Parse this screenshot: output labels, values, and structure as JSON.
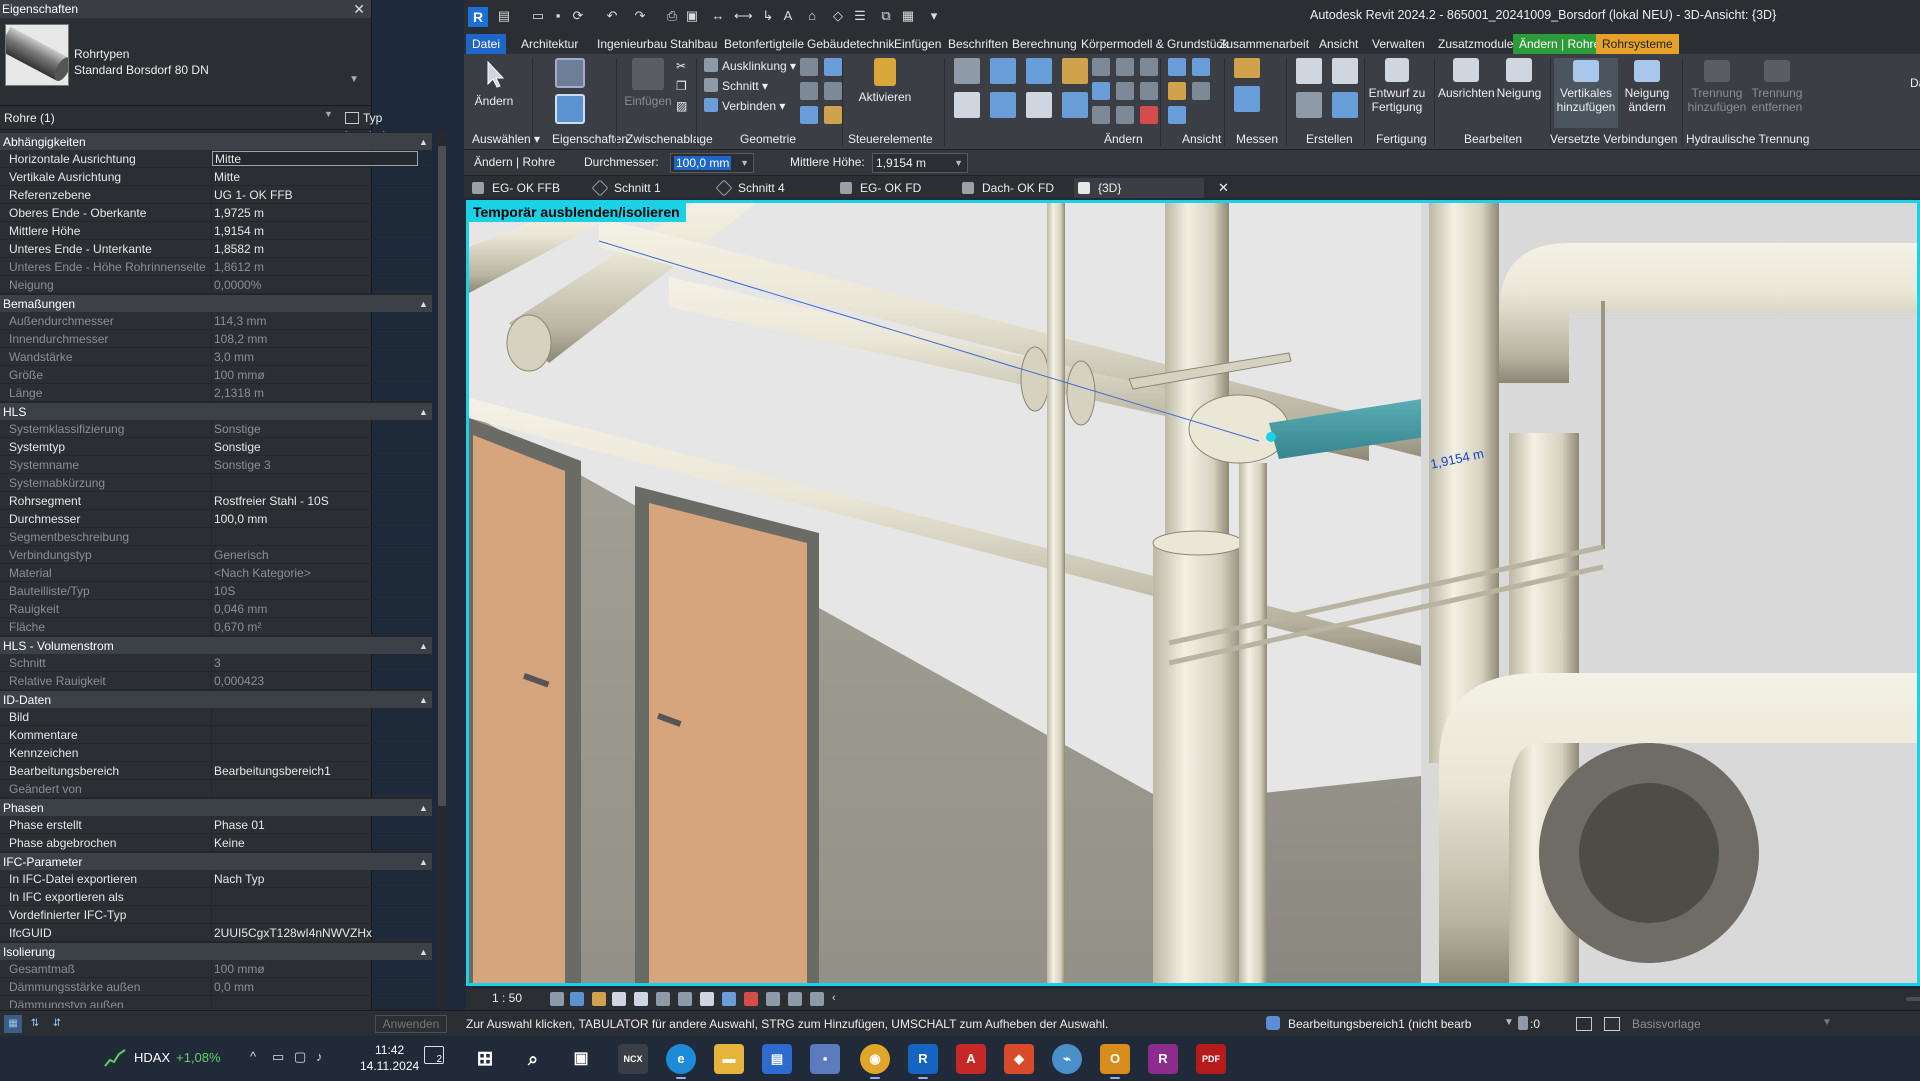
{
  "properties": {
    "title": "Eigenschaften",
    "type_family": "Rohrtypen",
    "type_name": "Standard Borsdorf 80 DN",
    "instance_filter": "Rohre (1)",
    "edit_type": "Typ bearbeiten",
    "apply": "Anwenden",
    "sections": [
      {
        "title": "Abhängigkeiten",
        "rows": [
          {
            "name": "Horizontale Ausrichtung",
            "value": "Mitte",
            "state": "edit"
          },
          {
            "name": "Vertikale Ausrichtung",
            "value": "Mitte",
            "state": ""
          },
          {
            "name": "Referenzebene",
            "value": "UG 1- OK FFB",
            "state": ""
          },
          {
            "name": "Oberes Ende - Oberkante",
            "value": "1,9725 m",
            "state": ""
          },
          {
            "name": "Mittlere Höhe",
            "value": "1,9154 m",
            "state": ""
          },
          {
            "name": "Unteres Ende - Unterkante",
            "value": "1,8582 m",
            "state": ""
          },
          {
            "name": "Unteres Ende - Höhe Rohrinnenseite",
            "value": "1,8612 m",
            "state": "dim"
          },
          {
            "name": "Neigung",
            "value": "0,0000%",
            "state": "dim"
          }
        ]
      },
      {
        "title": "Bemaßungen",
        "rows": [
          {
            "name": "Außendurchmesser",
            "value": "114,3 mm",
            "state": "dim"
          },
          {
            "name": "Innendurchmesser",
            "value": "108,2 mm",
            "state": "dim"
          },
          {
            "name": "Wandstärke",
            "value": "3,0 mm",
            "state": "dim"
          },
          {
            "name": "Größe",
            "value": "100 mmø",
            "state": "dim"
          },
          {
            "name": "Länge",
            "value": "2,1318 m",
            "state": "dim"
          }
        ]
      },
      {
        "title": "HLS",
        "rows": [
          {
            "name": "Systemklassifizierung",
            "value": "Sonstige",
            "state": "dim"
          },
          {
            "name": "Systemtyp",
            "value": "Sonstige",
            "state": ""
          },
          {
            "name": "Systemname",
            "value": "Sonstige 3",
            "state": "dim"
          },
          {
            "name": "Systemabkürzung",
            "value": "",
            "state": "dim"
          },
          {
            "name": "Rohrsegment",
            "value": "Rostfreier Stahl - 10S",
            "state": ""
          },
          {
            "name": "Durchmesser",
            "value": "100,0 mm",
            "state": ""
          },
          {
            "name": "Segmentbeschreibung",
            "value": "",
            "state": "dim"
          },
          {
            "name": "Verbindungstyp",
            "value": "Generisch",
            "state": "dim"
          },
          {
            "name": "Material",
            "value": "<Nach Kategorie>",
            "state": "dim"
          },
          {
            "name": "Bauteilliste/Typ",
            "value": "10S",
            "state": "dim"
          },
          {
            "name": "Rauigkeit",
            "value": "0,046 mm",
            "state": "dim"
          },
          {
            "name": "Fläche",
            "value": "0,670 m²",
            "state": "dim"
          }
        ]
      },
      {
        "title": "HLS - Volumenstrom",
        "rows": [
          {
            "name": "Schnitt",
            "value": "3",
            "state": "dim"
          },
          {
            "name": "Relative Rauigkeit",
            "value": "0,000423",
            "state": "dim"
          }
        ]
      },
      {
        "title": "ID-Daten",
        "rows": [
          {
            "name": "Bild",
            "value": "",
            "state": ""
          },
          {
            "name": "Kommentare",
            "value": "",
            "state": ""
          },
          {
            "name": "Kennzeichen",
            "value": "",
            "state": ""
          },
          {
            "name": "Bearbeitungsbereich",
            "value": "Bearbeitungsbereich1",
            "state": ""
          },
          {
            "name": "Geändert von",
            "value": "",
            "state": "dim"
          }
        ]
      },
      {
        "title": "Phasen",
        "rows": [
          {
            "name": "Phase erstellt",
            "value": "Phase 01",
            "state": ""
          },
          {
            "name": "Phase abgebrochen",
            "value": "Keine",
            "state": ""
          }
        ]
      },
      {
        "title": "IFC-Parameter",
        "rows": [
          {
            "name": "In IFC-Datei exportieren",
            "value": "Nach Typ",
            "state": ""
          },
          {
            "name": "In IFC exportieren als",
            "value": "",
            "state": ""
          },
          {
            "name": "Vordefinierter IFC-Typ",
            "value": "",
            "state": ""
          },
          {
            "name": "IfcGUID",
            "value": "2UUI5CgxT128wI4nNWVZHx",
            "state": ""
          }
        ]
      },
      {
        "title": "Isolierung",
        "rows": [
          {
            "name": "Gesamtmaß",
            "value": "100 mmø",
            "state": "dim"
          },
          {
            "name": "Dämmungsstärke außen",
            "value": "0,0 mm",
            "state": "dim"
          },
          {
            "name": "Dämmungstyp außen",
            "value": "",
            "state": "dim"
          }
        ]
      }
    ]
  },
  "window_title": "Autodesk Revit 2024.2 - 865001_20241009_Borsdorf (lokal NEU) - 3D-Ansicht: {3D}",
  "ribbon_tabs": [
    "Datei",
    "Architektur",
    "Ingenieurbau",
    "Stahlbau",
    "Betonfertigteile",
    "Gebäudetechnik",
    "Einfügen",
    "Beschriften",
    "Berechnung",
    "Körpermodell & Grundstück",
    "Zusammenarbeit",
    "Ansicht",
    "Verwalten",
    "Zusatzmodule",
    "Ändern | Rohre",
    "Rohrsysteme"
  ],
  "ribbon": {
    "modify": "Ändern",
    "select": "Auswählen",
    "properties": "Eigenschaften",
    "paste": "Einfügen",
    "clipboard": "Zwischenablage",
    "cope": "Ausklinkung",
    "cut": "Schnitt",
    "join": "Verbinden",
    "geometry": "Geometrie",
    "activate": "Aktivieren",
    "controls": "Steuerelemente",
    "modify_group": "Ändern",
    "view": "Ansicht",
    "measure": "Messen",
    "create": "Erstellen",
    "design_to_fab": "Entwurf zu Fertigung",
    "fabrication": "Fertigung",
    "justify": "Ausrichten",
    "slope": "Neigung",
    "edit": "Bearbeiten",
    "add_vertical": "Vertikales hinzufügen",
    "change_slope": "Neigung ändern",
    "offset_connections": "Versetzte Verbindungen",
    "add_separation": "Trennung hinzufügen",
    "remove_separation": "Trennung entfernen",
    "hydraulic_separation": "Hydraulische Trennung",
    "cut_off": "Dä"
  },
  "options_bar": {
    "context": "Ändern | Rohre",
    "diameter_label": "Durchmesser:",
    "diameter_value": "100,0 mm",
    "height_label": "Mittlere Höhe:",
    "height_value": "1,9154 m"
  },
  "view_tabs": [
    "EG- OK FFB",
    "Schnitt 1",
    "Schnitt 4",
    "EG- OK FD",
    "Dach- OK FD",
    "{3D}"
  ],
  "viewport": {
    "temp_label": "Temporär ausblenden/isolieren",
    "dimension": "1,9154 m",
    "scale": "1 : 50"
  },
  "status": {
    "message": "Zur Auswahl klicken, TABULATOR für andere Auswahl, STRG zum Hinzufügen, UMSCHALT zum Aufheben der Auswahl.",
    "workset": "Bearbeitungsbereich1 (nicht bearb",
    "counter": ":0",
    "template": "Basisvorlage"
  },
  "taskbar": {
    "ticker": "HDAX",
    "ticker_change": "+1,08%",
    "time": "11:42",
    "date": "14.11.2024",
    "notifications": "2"
  },
  "colors": {
    "accent": "#1e66c8",
    "highlight": "#1ad1e6",
    "context_tab_modify": "#2c9b3a",
    "context_tab_systems": "#e5a12a"
  }
}
